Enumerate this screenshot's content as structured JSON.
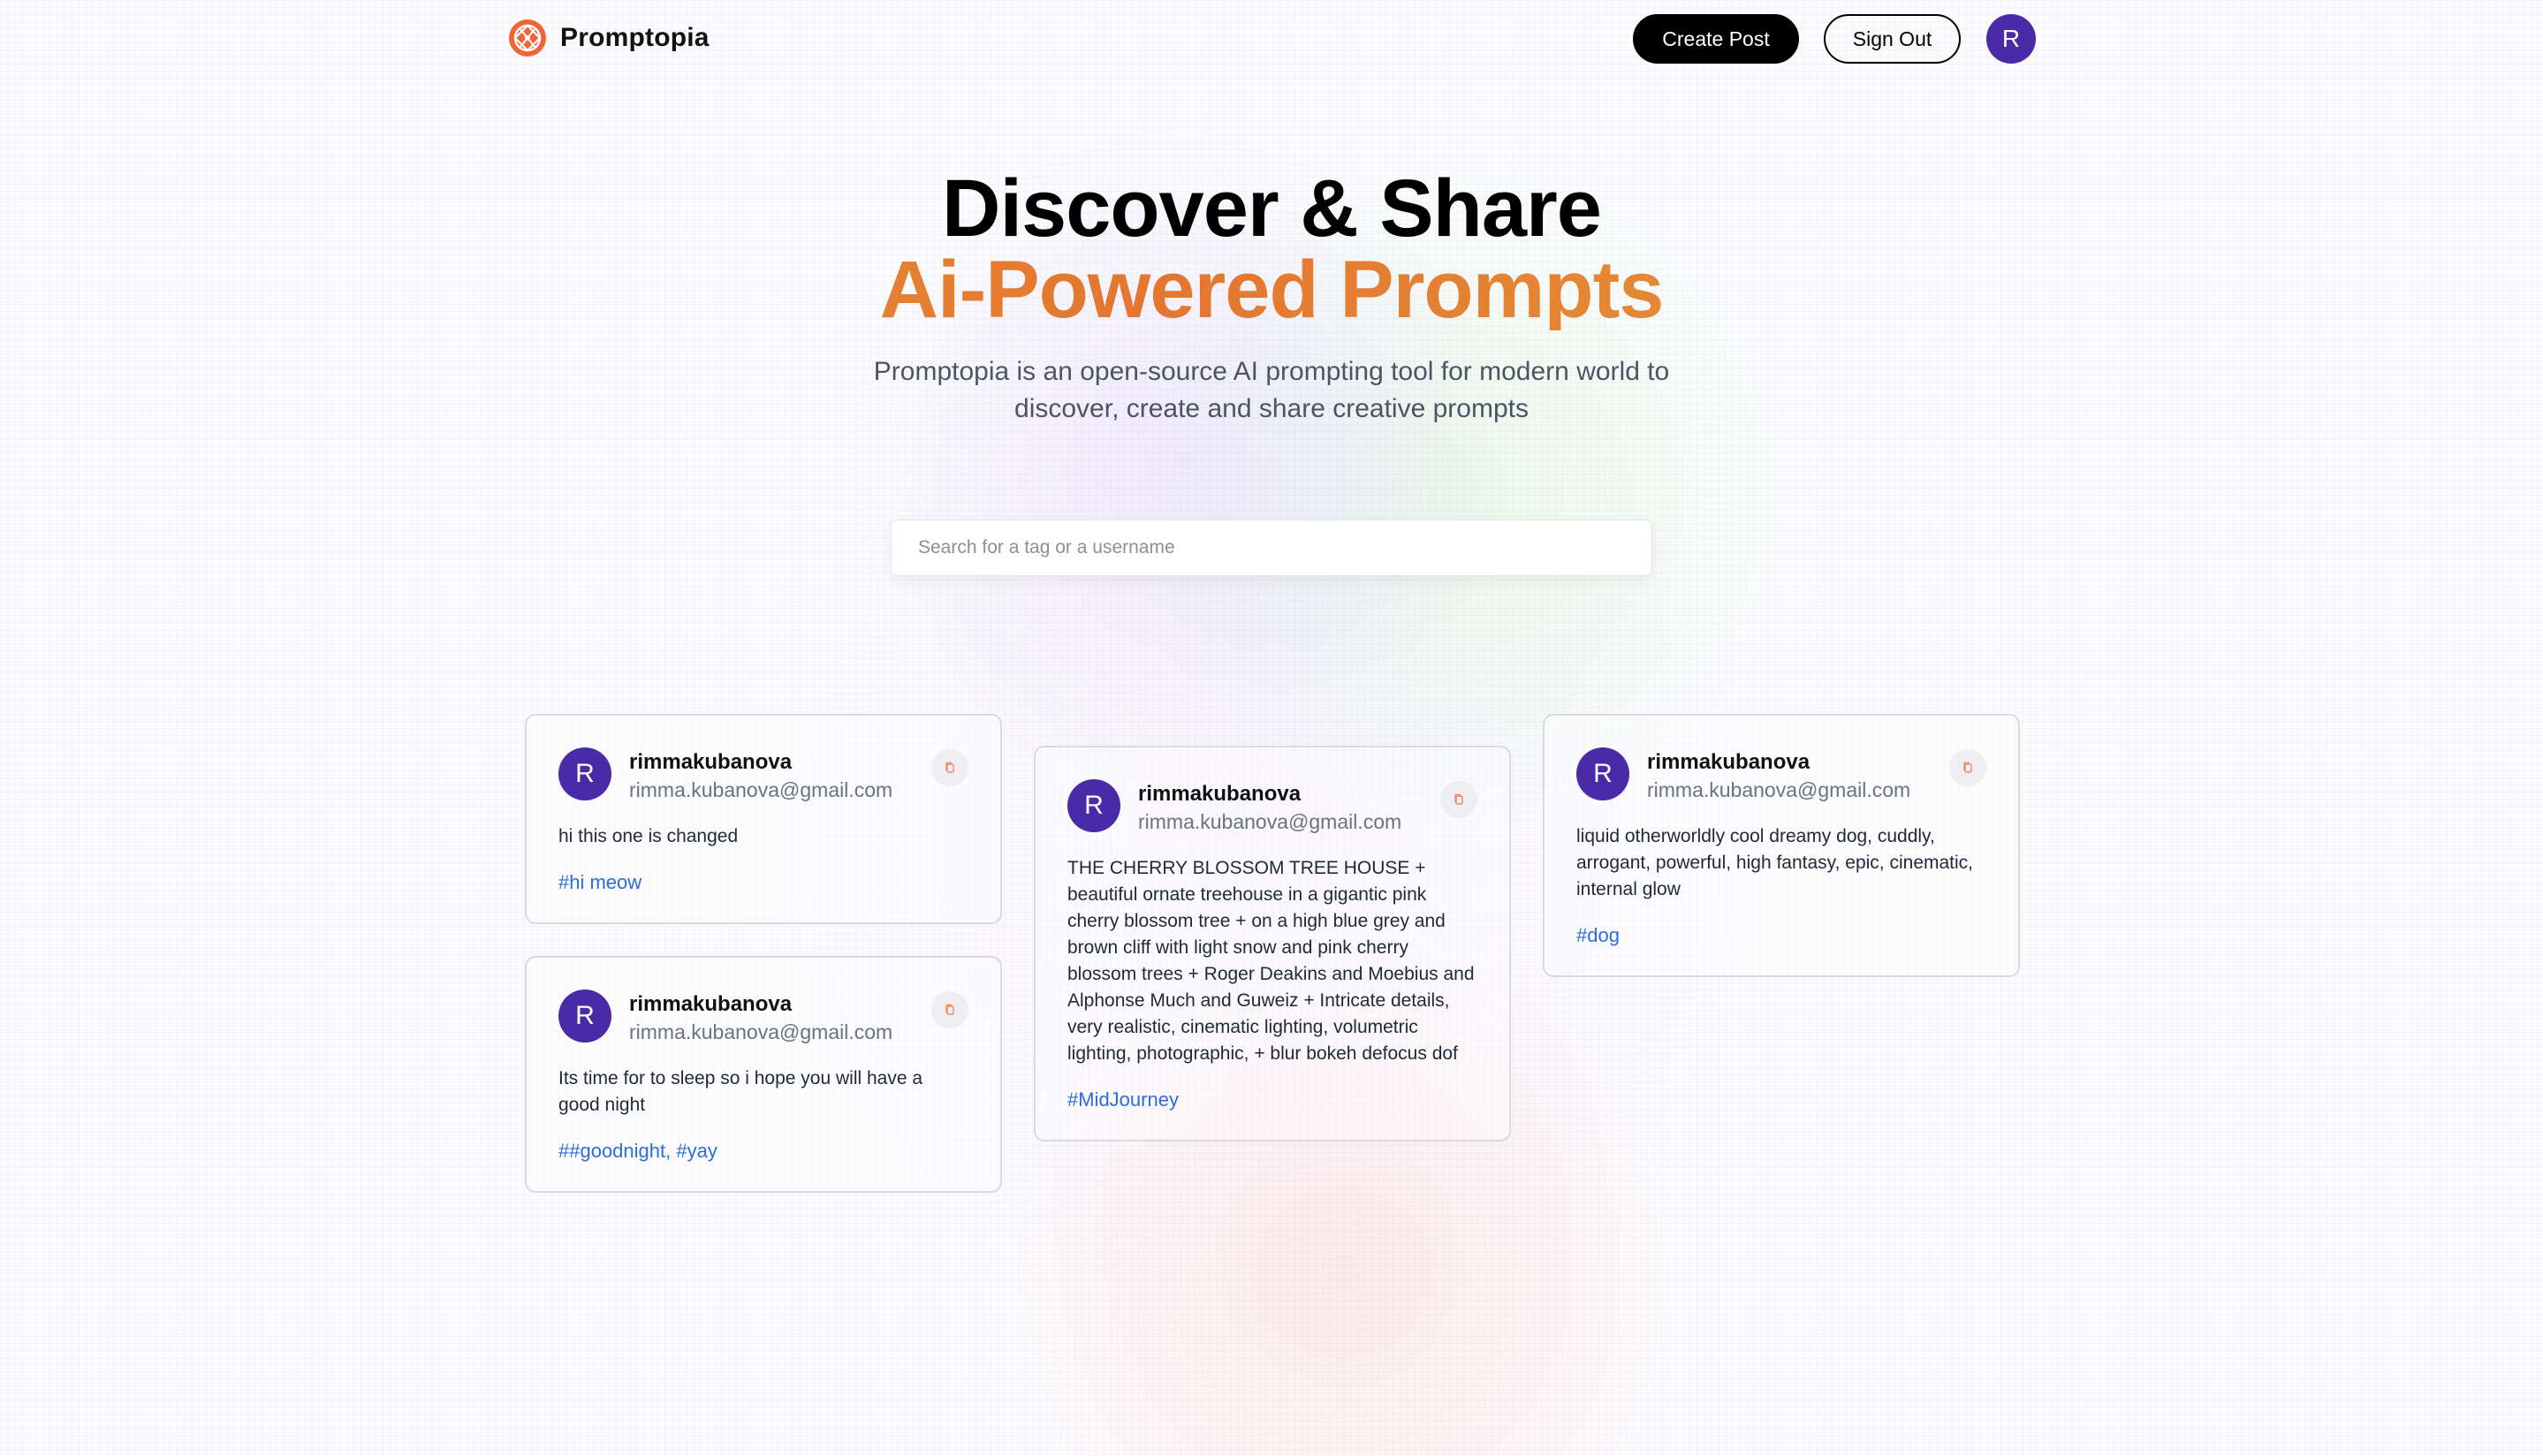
{
  "brand": {
    "name": "Promptopia"
  },
  "nav": {
    "create_label": "Create Post",
    "signout_label": "Sign Out",
    "avatar_initial": "R"
  },
  "hero": {
    "title_line1": "Discover & Share",
    "title_line2": "Ai-Powered Prompts",
    "description": "Promptopia is an open-source AI prompting tool for modern world to discover, create and share creative prompts"
  },
  "search": {
    "placeholder": "Search for a tag or a username",
    "value": ""
  },
  "colors": {
    "accent_orange": "#e4762f",
    "avatar_purple": "#4a2aa6",
    "tag_blue": "#2b6ed9"
  },
  "posts": [
    {
      "avatar_initial": "R",
      "username": "rimmakubanova",
      "email": "rimma.kubanova@gmail.com",
      "prompt": "hi this one is changed",
      "tag": "#hi meow",
      "icon": "copy-icon"
    },
    {
      "avatar_initial": "R",
      "username": "rimmakubanova",
      "email": "rimma.kubanova@gmail.com",
      "prompt": "Its time for to sleep so i hope you will have a good night",
      "tag": "##goodnight, #yay",
      "icon": "copy-icon"
    },
    {
      "avatar_initial": "R",
      "username": "rimmakubanova",
      "email": "rimma.kubanova@gmail.com",
      "prompt": "THE CHERRY BLOSSOM TREE HOUSE + beautiful ornate treehouse in a gigantic pink cherry blossom tree + on a high blue grey and brown cliff with light snow and pink cherry blossom trees + Roger Deakins and Moebius and Alphonse Much and Guweiz + Intricate details, very realistic, cinematic lighting, volumetric lighting, photographic, + blur bokeh defocus dof",
      "tag": "#MidJourney",
      "icon": "copy-icon"
    },
    {
      "avatar_initial": "R",
      "username": "rimmakubanova",
      "email": "rimma.kubanova@gmail.com",
      "prompt": "liquid otherworldly cool dreamy dog, cuddly, arrogant, powerful, high fantasy, epic, cinematic, internal glow",
      "tag": "#dog",
      "icon": "copy-icon"
    }
  ]
}
